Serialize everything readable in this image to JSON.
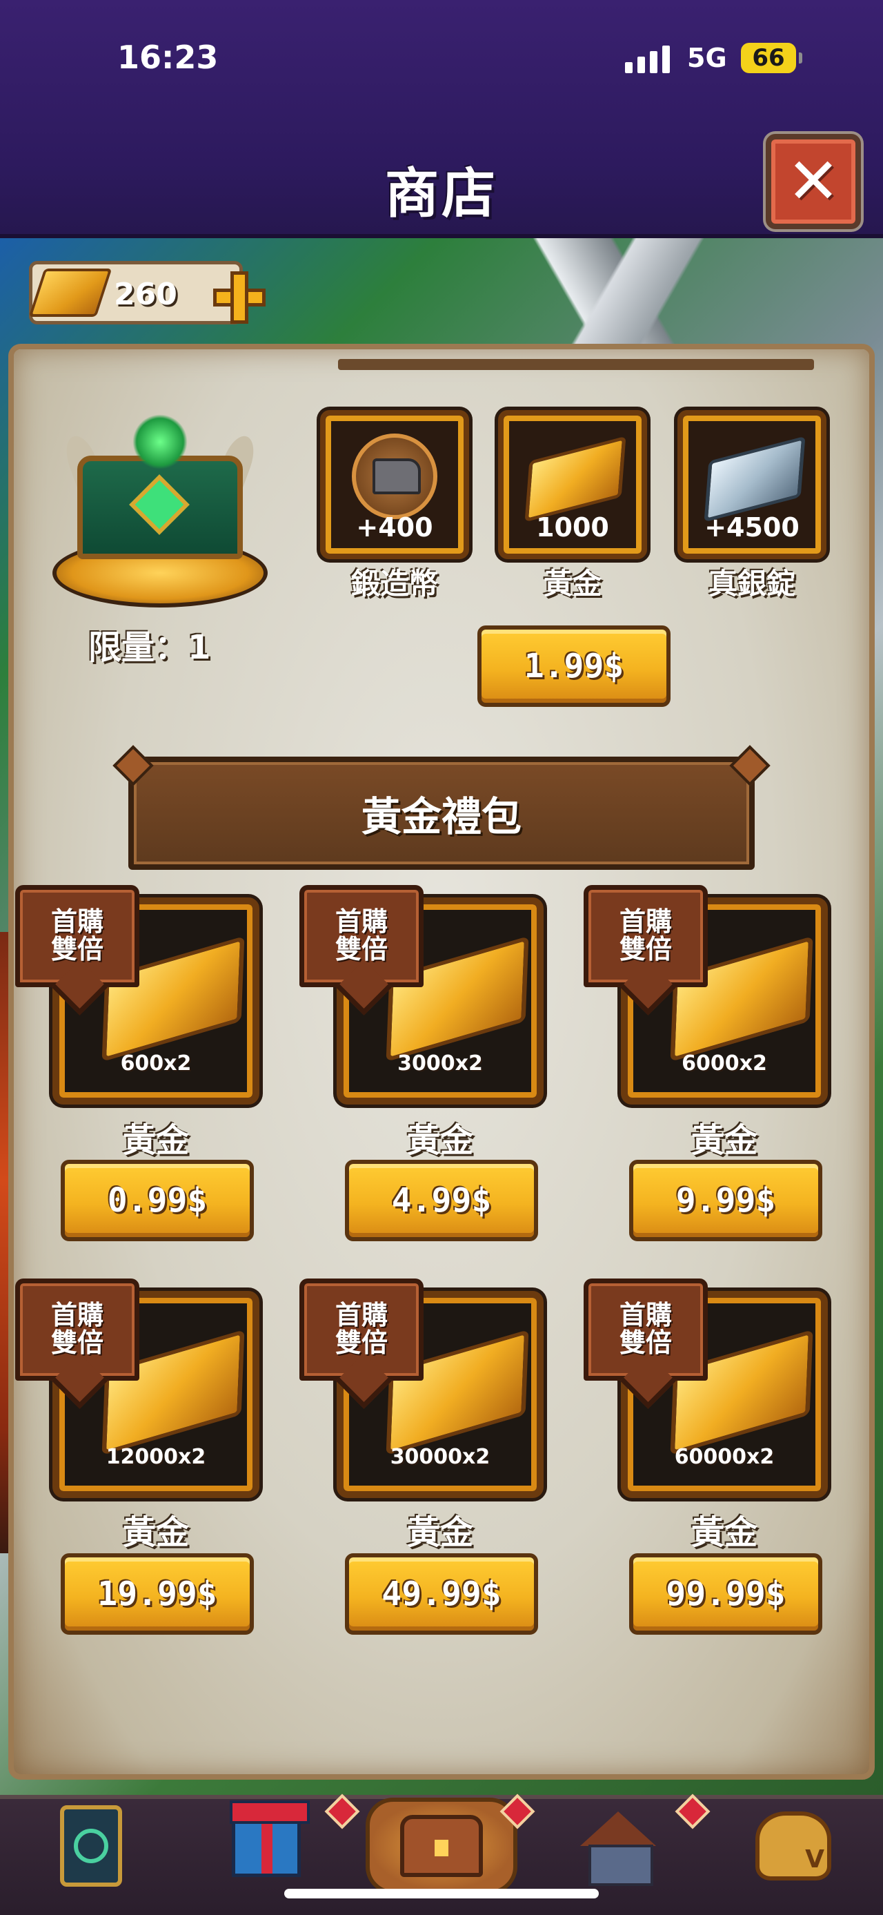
{
  "status_bar": {
    "time": "16:23",
    "network": "5G",
    "battery": "66"
  },
  "header": {
    "title": "商店",
    "close_icon": "close-icon"
  },
  "currency": {
    "amount": "260",
    "icon": "gold-bar-icon",
    "add_icon": "plus-icon"
  },
  "featured": {
    "limit_label": "限量：1",
    "items": [
      {
        "qty": "+400",
        "name": "鍛造幣",
        "icon": "anvil-coin-icon"
      },
      {
        "qty": "1000",
        "name": "黃金",
        "icon": "gold-bar-icon"
      },
      {
        "qty": "+4500",
        "name": "真銀錠",
        "icon": "silver-ingot-icon"
      }
    ],
    "price": "1.99$"
  },
  "gold_pack": {
    "title": "黃金禮包",
    "badge_line1": "首購",
    "badge_line2": "雙倍",
    "offers": [
      {
        "qty": "600x2",
        "name": "黃金",
        "price": "0.99$"
      },
      {
        "qty": "3000x2",
        "name": "黃金",
        "price": "4.99$"
      },
      {
        "qty": "6000x2",
        "name": "黃金",
        "price": "9.99$"
      },
      {
        "qty": "12000x2",
        "name": "黃金",
        "price": "19.99$"
      },
      {
        "qty": "30000x2",
        "name": "黃金",
        "price": "49.99$"
      },
      {
        "qty": "60000x2",
        "name": "黃金",
        "price": "99.99$"
      }
    ]
  },
  "bottom_nav": {
    "items": [
      {
        "icon": "card-icon"
      },
      {
        "icon": "gift-icon"
      },
      {
        "icon": "treasure-chest-icon",
        "active": true
      },
      {
        "icon": "house-icon"
      },
      {
        "icon": "money-bag-icon"
      }
    ]
  },
  "colors": {
    "header_bg": "#2d1a5e",
    "button_gold": "#f4b320",
    "frame_brown": "#6b3a0e",
    "parchment": "#d6d2c4"
  }
}
